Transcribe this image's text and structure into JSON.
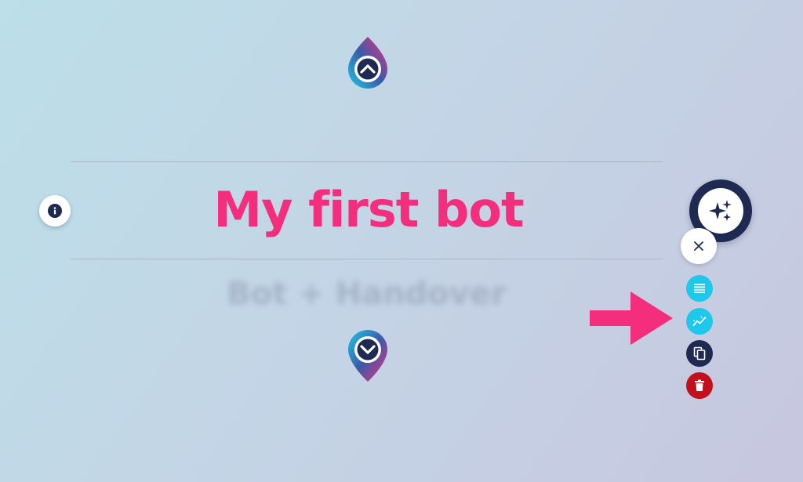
{
  "bot": {
    "title": "My first bot",
    "subtitle": "Bot + Handover"
  },
  "colors": {
    "title": "#f42e7c",
    "navy": "#1f2a52",
    "cyan": "#1ec8ea",
    "danger": "#c3101c",
    "arrow": "#f42e7c"
  },
  "icons": {
    "nav_up": "chevron-up-icon",
    "nav_down": "chevron-down-icon",
    "info": "info-icon",
    "magic": "sparkles-icon",
    "close": "close-icon",
    "list": "list-icon",
    "analytics": "analytics-icon",
    "copy": "copy-icon",
    "delete": "trash-icon",
    "pointer": "arrow-right-icon"
  }
}
